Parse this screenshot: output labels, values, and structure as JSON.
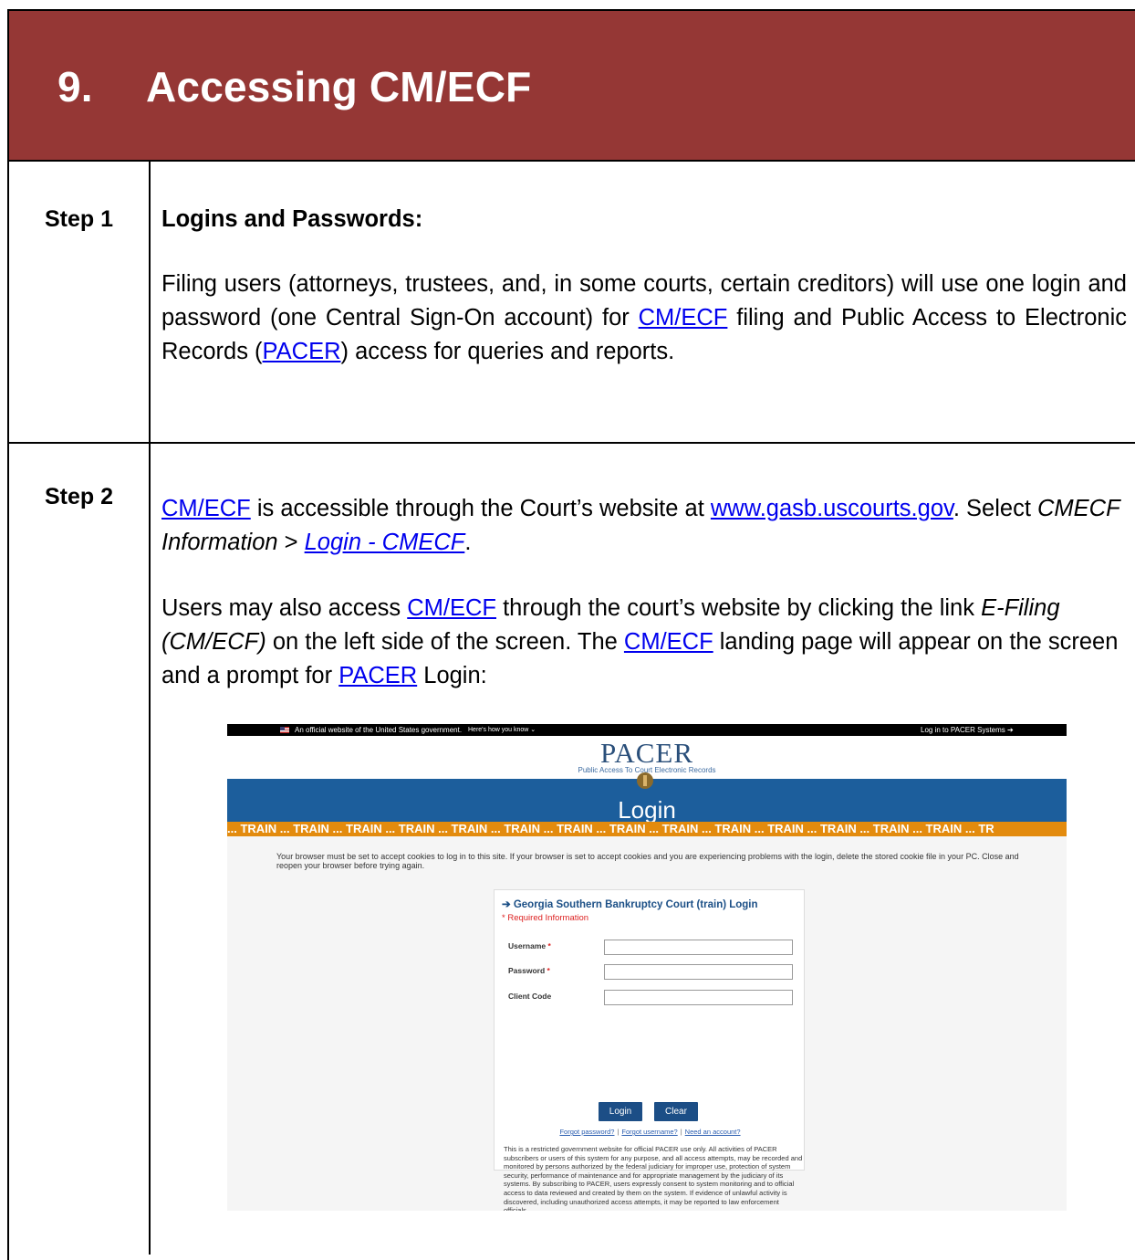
{
  "section": {
    "number": "9.",
    "title": "Accessing CM/ECF"
  },
  "step1": {
    "label": "Step 1",
    "heading": "Logins and Passwords:",
    "p1": "Filing users (attorneys, trustees, and, in some courts, certain creditors) will use one login and password (one Central Sign-On account) for ",
    "link_cmecf": "CM/ECF",
    "p2": " filing and Public Access to Electronic Records (",
    "link_pacer": "PACER",
    "p3": ") access for queries and reports."
  },
  "step2": {
    "label": "Step 2",
    "link_cmecf": "CM/ECF",
    "a1": " is accessible through the Court’s website at ",
    "link_site": "www.gasb.uscourts.gov",
    "a2": ". Select ",
    "menu_item": "CMECF Information",
    "a3": " > ",
    "link_login": "Login - CMECF",
    "a4": ".",
    "b1": "Users may also access ",
    "b2": " through the court’s website by clicking the link ",
    "efiling": "E-Filing (CM/ECF)",
    "b3": " on the left side of the screen. The ",
    "b4": " landing page will appear on the screen and a prompt for ",
    "link_pacer": "PACER",
    "b5": " Login:"
  },
  "screenshot": {
    "official_text": "An official website of the United States government.",
    "how_text": "Here's how you know ⌄",
    "login_systems": "Log in to PACER Systems ➔",
    "logo": "PACER",
    "tagline": "Public Access To Court Electronic Records",
    "page_title": "Login",
    "train_text": "... TRAIN ... TRAIN ... TRAIN ... TRAIN ... TRAIN ... TRAIN ... TRAIN ... TRAIN ... TRAIN ... TRAIN ... TRAIN ... TRAIN ... TRAIN ... TRAIN ... TR",
    "cookie_notice": "Your browser must be set to accept cookies to log in to this site. If your browser is set to accept cookies and you are experiencing problems with the login, delete the stored cookie file in your PC. Close and reopen your browser before trying again.",
    "box_title": "➔ Georgia Southern Bankruptcy Court (train) Login",
    "required": "* Required Information",
    "username_label": "Username",
    "password_label": "Password",
    "client_label": "Client Code",
    "star": "*",
    "login_btn": "Login",
    "clear_btn": "Clear",
    "forgot_password": "Forgot password?",
    "forgot_username": "Forgot username?",
    "need_account": "Need an account?",
    "sep": "|",
    "notice": "This is a restricted government website for official PACER use only. All activities of PACER subscribers or users of this system for any purpose, and all access attempts, may be recorded and monitored by persons authorized by the federal judiciary for improper use, protection of system security, performance of maintenance and for appropriate management by the judiciary of its systems. By subscribing to PACER, users expressly consent to system monitoring and to official access to data reviewed and created by them on the system. If evidence of unlawful activity is discovered, including unauthorized access attempts, it may be reported to law enforcement officials."
  },
  "colors": {
    "header_bg": "#953735",
    "link": "#0000ee",
    "pacer_blue": "#1c5e9c",
    "train_orange": "#e38b0e"
  }
}
